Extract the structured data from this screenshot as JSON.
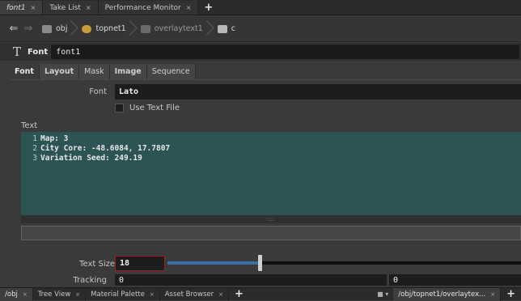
{
  "tabs_top": [
    {
      "label": "font1",
      "active": true
    },
    {
      "label": "Take List",
      "active": false
    },
    {
      "label": "Performance Monitor",
      "active": false
    }
  ],
  "path": [
    "obj",
    "topnet1",
    "overlaytext1",
    "c"
  ],
  "node": {
    "type": "Font",
    "name": "font1"
  },
  "param_tabs": [
    "Font",
    "Layout",
    "Mask",
    "Image",
    "Sequence"
  ],
  "font": {
    "label": "Font",
    "value": "Lato",
    "use_text_file": "Use Text File"
  },
  "text": {
    "label": "Text",
    "lines": [
      {
        "num": "1",
        "content": "Map: 3"
      },
      {
        "num": "2",
        "content": "City Core: -48.6084, 17.7807"
      },
      {
        "num": "3",
        "content": "Variation Seed: 249.19"
      }
    ],
    "grip": ":::"
  },
  "text_size": {
    "label": "Text Size",
    "value": "18",
    "slider_fraction": 0.26
  },
  "tracking": {
    "label": "Tracking",
    "value1": "0",
    "value2": "0"
  },
  "bottom_tabs": [
    "/obj",
    "Tree View",
    "Material Palette",
    "Asset Browser"
  ],
  "bottom_right_tab": "/obj/topnet1/overlaytex...",
  "icons": {
    "close": "×",
    "add": "+",
    "back": "arrow-left-icon",
    "forward": "arrow-right-icon"
  },
  "colors": {
    "text_bg": "#2d5454",
    "slider_fill": "#3c6ea8",
    "text_size_border": "#a02020"
  }
}
